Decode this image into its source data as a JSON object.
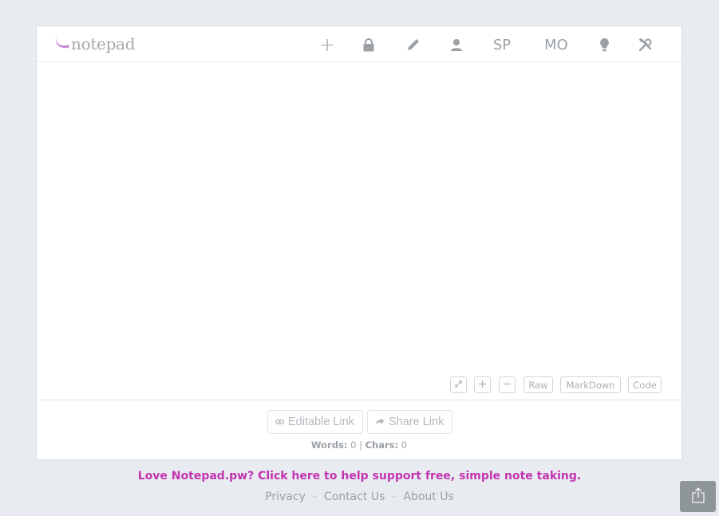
{
  "header": {
    "logo_text": "notepad",
    "toolbar": {
      "new_label": "+",
      "sp_label": "SP",
      "mo_label": "MO"
    }
  },
  "editor": {
    "value": "",
    "placeholder": ""
  },
  "editor_controls": {
    "raw_label": "Raw",
    "markdown_label": "MarkDown",
    "code_label": "Code"
  },
  "links": {
    "editable_label": "Editable Link",
    "share_label": "Share Link"
  },
  "stats": {
    "words_label": "Words:",
    "words_value": "0",
    "chars_label": "Chars:",
    "chars_value": "0",
    "separator": "|"
  },
  "promo": {
    "text": "Love Notepad.pw? Click here to help support free, simple note taking."
  },
  "footer": {
    "privacy": "Privacy",
    "contact": "Contact Us",
    "about": "About Us",
    "separator": "–"
  },
  "colors": {
    "background": "#e8ecf1",
    "accent": "#c233b0",
    "logo_mark": "#c98ad6",
    "icon_gray": "#9aa0a6",
    "fab": "#8f9699"
  }
}
